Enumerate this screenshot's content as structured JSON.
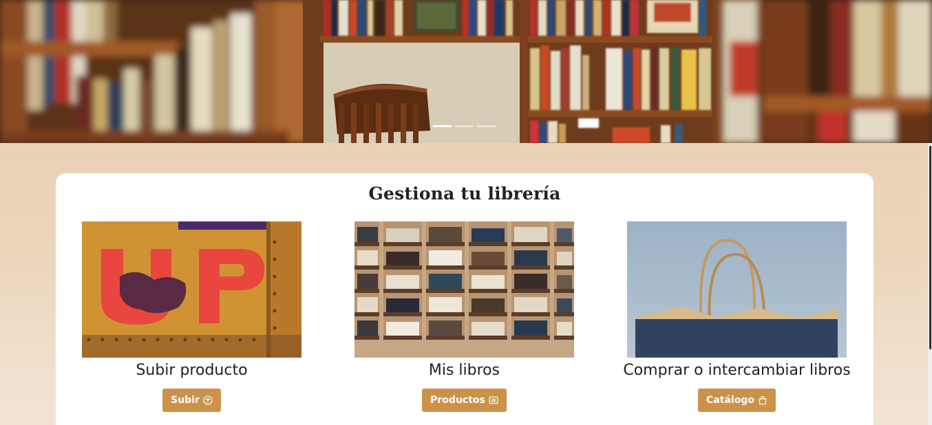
{
  "carousel": {
    "slides": [
      {
        "image": "bookstore-interior-with-wooden-chair",
        "active": true
      },
      {
        "image": "slide-2",
        "active": false
      },
      {
        "image": "slide-3",
        "active": false
      }
    ]
  },
  "section": {
    "title": "Gestiona tu librería"
  },
  "features": [
    {
      "image": "rusty-metal-UP-letters",
      "title": "Subir producto",
      "button_label": "Subir",
      "button_icon": "arrow-up-circle-icon"
    },
    {
      "image": "wooden-bookshelf-full-of-books",
      "title": "Mis libros",
      "button_label": "Productos",
      "button_icon": "card-list-icon"
    },
    {
      "image": "paper-shopping-bag",
      "title": "Comprar o intercambiar libros",
      "button_label": "Catálogo",
      "button_icon": "shopping-bag-icon"
    }
  ],
  "colors": {
    "accent": "#cc924a",
    "page_background_top": "#e8ccaa",
    "page_background_bottom": "#f2e4d4",
    "card_background": "#ffffff"
  }
}
